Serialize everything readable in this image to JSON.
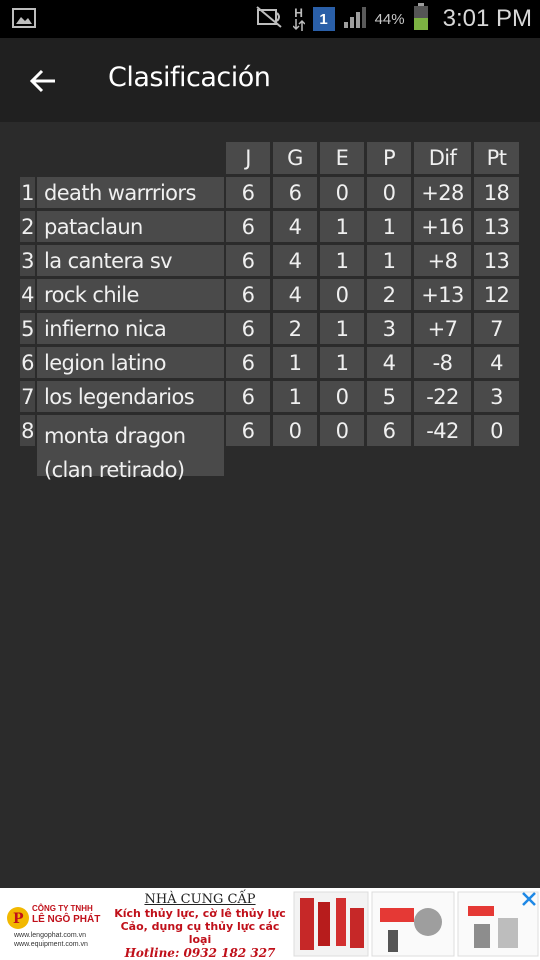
{
  "status_bar": {
    "battery_percent": "44%",
    "time": "3:01 PM",
    "network_type": "H",
    "notification_count": "1"
  },
  "app_bar": {
    "title": "Clasificación",
    "back_icon": "arrow-left-icon"
  },
  "table": {
    "headers": [
      "J",
      "G",
      "E",
      "P",
      "Dif",
      "Pt"
    ],
    "rows": [
      {
        "rank": "1",
        "team": "death warrriors",
        "J": "6",
        "G": "6",
        "E": "0",
        "P": "0",
        "Dif": "+28",
        "Pt": "18"
      },
      {
        "rank": "2",
        "team": "pataclaun",
        "J": "6",
        "G": "4",
        "E": "1",
        "P": "1",
        "Dif": "+16",
        "Pt": "13"
      },
      {
        "rank": "3",
        "team": "la cantera sv",
        "J": "6",
        "G": "4",
        "E": "1",
        "P": "1",
        "Dif": "+8",
        "Pt": "13"
      },
      {
        "rank": "4",
        "team": "rock chile",
        "J": "6",
        "G": "4",
        "E": "0",
        "P": "2",
        "Dif": "+13",
        "Pt": "12"
      },
      {
        "rank": "5",
        "team": "infierno nica",
        "J": "6",
        "G": "2",
        "E": "1",
        "P": "3",
        "Dif": "+7",
        "Pt": "7"
      },
      {
        "rank": "6",
        "team": "legion latino",
        "J": "6",
        "G": "1",
        "E": "1",
        "P": "4",
        "Dif": "-8",
        "Pt": "4"
      },
      {
        "rank": "7",
        "team": "los legendarios",
        "J": "6",
        "G": "1",
        "E": "0",
        "P": "5",
        "Dif": "-22",
        "Pt": "3"
      },
      {
        "rank": "8",
        "team": "monta dragon (clan retirado)",
        "J": "6",
        "G": "0",
        "E": "0",
        "P": "6",
        "Dif": "-42",
        "Pt": "0"
      }
    ]
  },
  "ad": {
    "company_line1": "CÔNG TY TNHH",
    "company_line2": "LÊ NGÔ PHÁT",
    "website1": "www.lengophat.com.vn",
    "website2": "www.equipment.com.vn",
    "heading": "NHÀ CUNG CẤP",
    "line1": "Kích thủy lực, cờ lê thủy lực",
    "line2": "Cảo, dụng cụ thủy lực các loại",
    "hotline": "Hotline: 0932 182 327"
  },
  "colors": {
    "background": "#2b2b2b",
    "app_bar": "#202020",
    "cell": "#4a4a4a",
    "status_bar": "#000000"
  }
}
